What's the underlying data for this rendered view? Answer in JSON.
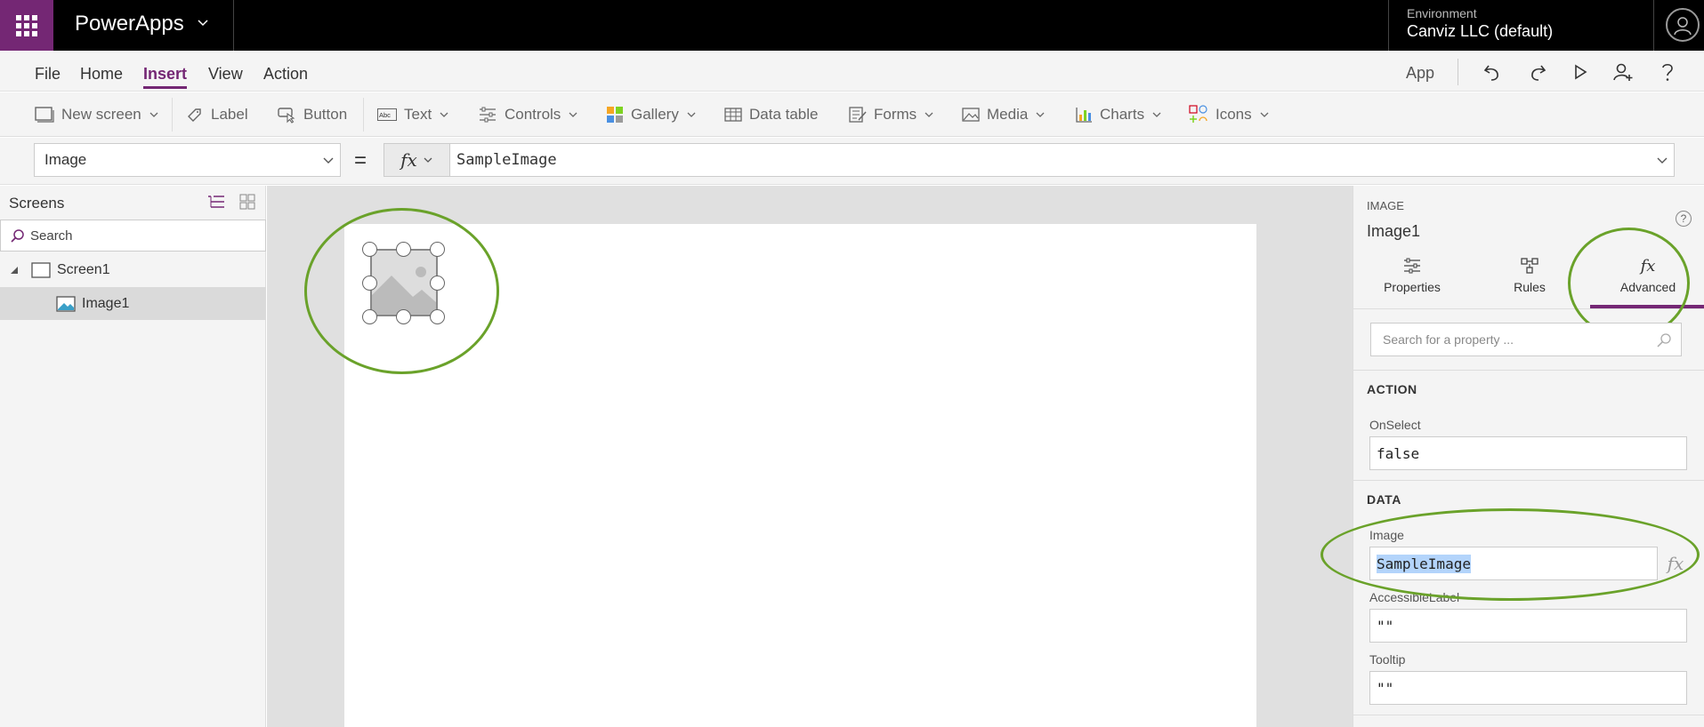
{
  "app": {
    "name": "PowerApps"
  },
  "environment": {
    "label": "Environment",
    "value": "Canviz LLC (default)"
  },
  "menu": {
    "items": [
      "File",
      "Home",
      "Insert",
      "View",
      "Action"
    ],
    "active": "Insert",
    "right_label": "App"
  },
  "ribbon": {
    "new_screen": "New screen",
    "label": "Label",
    "button": "Button",
    "text": "Text",
    "controls": "Controls",
    "gallery": "Gallery",
    "data_table": "Data table",
    "forms": "Forms",
    "media": "Media",
    "charts": "Charts",
    "icons": "Icons"
  },
  "formula_bar": {
    "property": "Image",
    "equals": "=",
    "fx": "fx",
    "formula": "SampleImage"
  },
  "left_panel": {
    "title": "Screens",
    "search_placeholder": "Search",
    "tree": [
      {
        "label": "Screen1"
      },
      {
        "label": "Image1"
      }
    ]
  },
  "right_panel": {
    "control_type": "IMAGE",
    "control_name": "Image1",
    "help": "?",
    "tabs": [
      {
        "label": "Properties"
      },
      {
        "label": "Rules"
      },
      {
        "label": "Advanced"
      }
    ],
    "active_tab": "Advanced",
    "search_placeholder": "Search for a property ...",
    "sections": {
      "action": {
        "title": "ACTION",
        "fields": [
          {
            "label": "OnSelect",
            "value": "false"
          }
        ]
      },
      "data": {
        "title": "DATA",
        "fields": [
          {
            "label": "Image",
            "value": "SampleImage"
          },
          {
            "label": "AccessibleLabel",
            "value": "\"\""
          },
          {
            "label": "Tooltip",
            "value": "\"\""
          }
        ]
      }
    },
    "fx_glyph": "fx"
  },
  "colors": {
    "brand": "#742774",
    "highlight_ring": "#6aa22a",
    "selection": "#b3d4fb"
  }
}
